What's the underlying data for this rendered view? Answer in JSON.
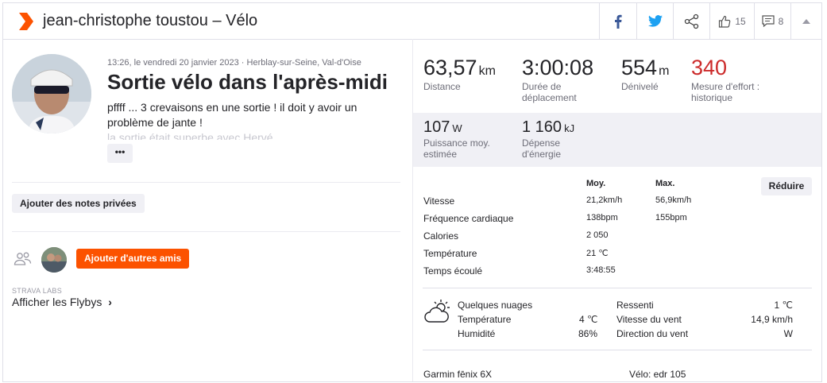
{
  "header": {
    "title": "jean-christophe toustou – Vélo",
    "kudos_count": "15",
    "comments_count": "8"
  },
  "activity": {
    "meta": "13:26, le vendredi 20 janvier 2023 · Herblay-sur-Seine, Val-d'Oise",
    "title": "Sortie vélo dans l'après-midi",
    "description": "pffff ... 3 crevaisons en une sortie ! il doit y avoir un problème de jante !",
    "description_more": "la sortie était superbe avec Hervé",
    "more_label": "•••"
  },
  "buttons": {
    "private_notes": "Ajouter des notes privées",
    "add_friends": "Ajouter d'autres amis",
    "reduce": "Réduire"
  },
  "labs": {
    "label": "STRAVA LABS",
    "flybys": "Afficher les Flybys"
  },
  "stats": {
    "distance": {
      "value": "63,57",
      "unit": "km",
      "label": "Distance"
    },
    "moving_time": {
      "value": "3:00:08",
      "label": "Durée de déplacement"
    },
    "elevation": {
      "value": "554",
      "unit": "m",
      "label": "Dénivelé"
    },
    "effort": {
      "value": "340",
      "label": "Mesure d'effort : historique"
    },
    "power": {
      "value": "107",
      "unit": "W",
      "label": "Puissance moy. estimée"
    },
    "energy": {
      "value": "1 160",
      "unit": "kJ",
      "label": "Dépense d'énergie"
    }
  },
  "details": {
    "col_avg": "Moy.",
    "col_max": "Max.",
    "rows": [
      {
        "label": "Vitesse",
        "avg": "21,2km/h",
        "max": "56,9km/h"
      },
      {
        "label": "Fréquence cardiaque",
        "avg": "138bpm",
        "max": "155bpm"
      },
      {
        "label": "Calories",
        "avg": "2 050",
        "max": ""
      },
      {
        "label": "Température",
        "avg": "21 ℃",
        "max": ""
      },
      {
        "label": "Temps écoulé",
        "avg": "3:48:55",
        "max": ""
      }
    ]
  },
  "weather": {
    "condition": "Quelques nuages",
    "temp_label": "Température",
    "temp_value": "4 ℃",
    "humidity_label": "Humidité",
    "humidity_value": "86%",
    "feels_label": "Ressenti",
    "feels_value": "1 ℃",
    "wind_speed_label": "Vitesse du vent",
    "wind_speed_value": "14,9 km/h",
    "wind_dir_label": "Direction du vent",
    "wind_dir_value": "W"
  },
  "equipment": {
    "device": "Garmin fēnix 6X",
    "bike": "Vélo: edr 105"
  },
  "colors": {
    "brand": "#fc5200",
    "effort": "#cc2b2b",
    "facebook": "#3b5998",
    "twitter": "#1da1f2"
  }
}
